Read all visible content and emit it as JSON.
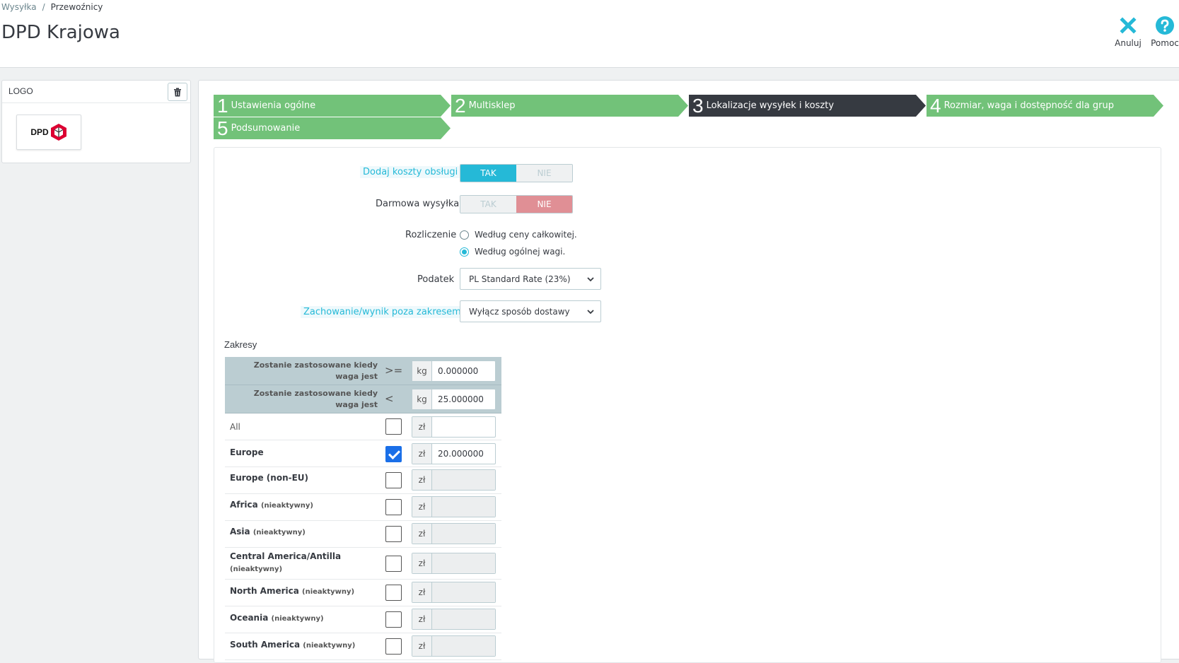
{
  "breadcrumb": {
    "parent": "Wysyłka",
    "separator": "/",
    "current": "Przewoźnicy"
  },
  "page_title": "DPD Krajowa",
  "toolbar": {
    "cancel_label": "Anuluj",
    "help_label": "Pomoc"
  },
  "logo_panel": {
    "title": "LOGO",
    "logo_text": "DPD"
  },
  "steps": [
    {
      "num": "1",
      "label": "Ustawienia ogólne",
      "state": "done"
    },
    {
      "num": "2",
      "label": "Multisklep",
      "state": "done"
    },
    {
      "num": "3",
      "label": "Lokalizacje wysyłek i koszty",
      "state": "active"
    },
    {
      "num": "4",
      "label": "Rozmiar, waga i dostępność dla grup",
      "state": "done"
    },
    {
      "num": "5",
      "label": "Podsumowanie",
      "state": "done"
    }
  ],
  "form": {
    "handling": {
      "label": "Dodaj koszty obsługi",
      "yes": "TAK",
      "no": "NIE",
      "value": "TAK"
    },
    "free_shipping": {
      "label": "Darmowa wysyłka",
      "yes": "TAK",
      "no": "NIE",
      "value": "NIE"
    },
    "billing": {
      "label": "Rozliczenie",
      "option_price": "Według ceny całkowitej.",
      "option_weight": "Według ogólnej wagi.",
      "selected": "weight"
    },
    "tax": {
      "label": "Podatek",
      "value": "PL Standard Rate (23%)"
    },
    "out_of_range": {
      "label": "Zachowanie/wynik poza zakresem",
      "value": "Wyłącz sposób dostawy"
    }
  },
  "ranges": {
    "title": "Zakresy",
    "head_rows": [
      {
        "label": "Zostanie zastosowane kiedy waga jest",
        "op": ">=",
        "unit": "kg",
        "value": "0.000000"
      },
      {
        "label": "Zostanie zastosowane kiedy waga jest",
        "op": "<",
        "unit": "kg",
        "value": "25.000000"
      }
    ],
    "currency": "zł",
    "inactive_label": "(nieaktywny)",
    "zones": [
      {
        "name": "All",
        "checked": false,
        "price": "",
        "inactive": false
      },
      {
        "name": "Europe",
        "checked": true,
        "price": "20.000000",
        "inactive": false
      },
      {
        "name": "Europe (non-EU)",
        "checked": false,
        "price": "",
        "inactive": false
      },
      {
        "name": "Africa",
        "checked": false,
        "price": "",
        "inactive": true
      },
      {
        "name": "Asia",
        "checked": false,
        "price": "",
        "inactive": true
      },
      {
        "name": "Central America/Antilla",
        "checked": false,
        "price": "",
        "inactive": true
      },
      {
        "name": "North America",
        "checked": false,
        "price": "",
        "inactive": true
      },
      {
        "name": "Oceania",
        "checked": false,
        "price": "",
        "inactive": true
      },
      {
        "name": "South America",
        "checked": false,
        "price": "",
        "inactive": true
      }
    ]
  },
  "colors": {
    "accent": "#25b9d7",
    "step_done": "#72c279",
    "step_active": "#363a41",
    "no_active": "#e08f95",
    "checkbox_checked": "#1a6fe8"
  }
}
